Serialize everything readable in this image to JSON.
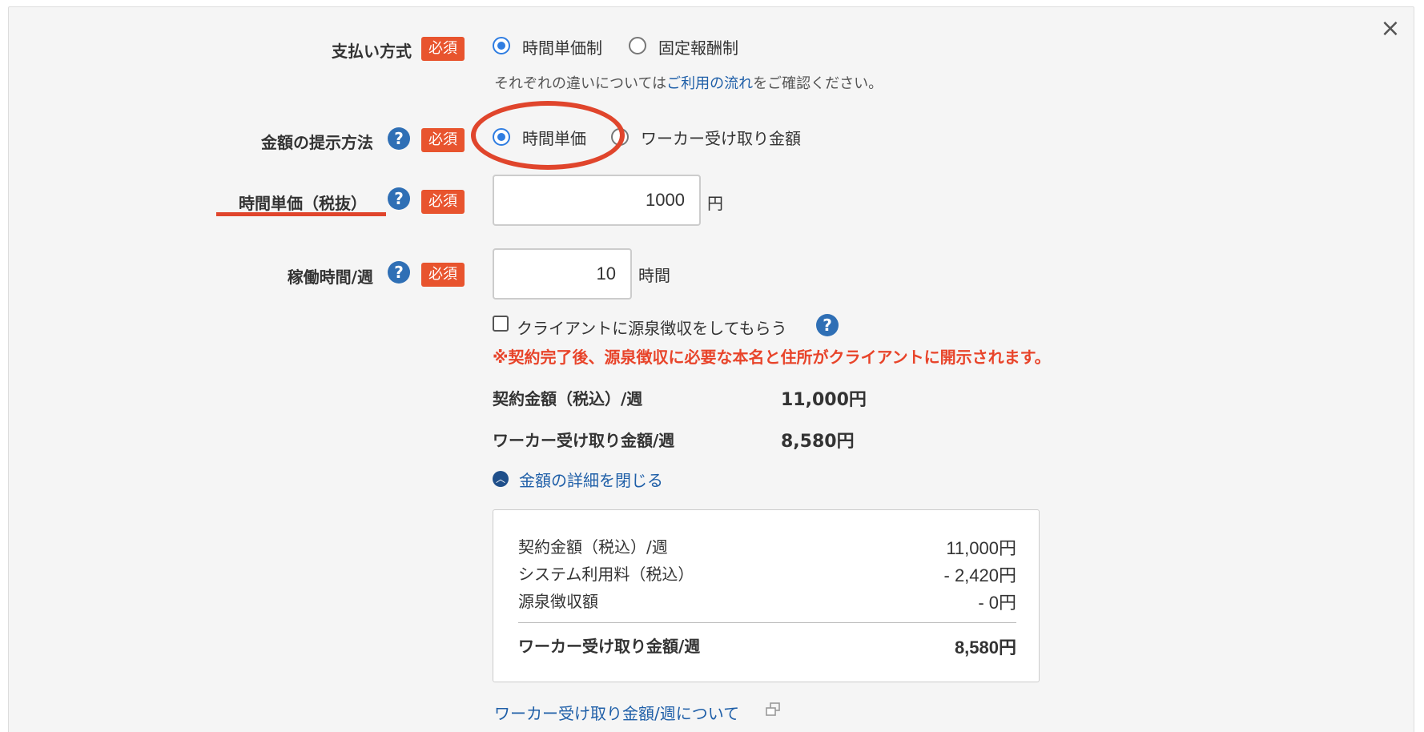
{
  "close_icon": "×",
  "payment_method": {
    "label": "支払い方式",
    "required": "必須",
    "options": [
      "時間単価制",
      "固定報酬制"
    ],
    "selected": "時間単価制",
    "note_prefix": "それぞれの違いについては",
    "note_link": "ご利用の流れ",
    "note_suffix": "をご確認ください。"
  },
  "amount_method": {
    "label": "金額の提示方法",
    "help": "?",
    "required": "必須",
    "options": [
      "時間単価",
      "ワーカー受け取り金額"
    ],
    "selected": "時間単価"
  },
  "hourly_rate": {
    "label": "時間単価（税抜）",
    "help": "?",
    "required": "必須",
    "value": "1000",
    "unit": "円"
  },
  "weekly_hours": {
    "label": "稼働時間/週",
    "help": "?",
    "required": "必須",
    "value": "10",
    "unit": "時間"
  },
  "withholding": {
    "checkbox_label": "クライアントに源泉徴収をしてもらう",
    "checked": false,
    "help": "?",
    "warning": "※契約完了後、源泉徴収に必要な本名と住所がクライアントに開示されます。"
  },
  "summary": {
    "contract_label": "契約金額（税込）/週",
    "contract_value": "11,000円",
    "worker_label": "ワーカー受け取り金額/週",
    "worker_value": "8,580円"
  },
  "details_toggle": {
    "icon": "chevron-up-icon",
    "label": "金額の詳細を閉じる"
  },
  "details": {
    "rows": [
      {
        "label": "契約金額（税込）/週",
        "value": "11,000円"
      },
      {
        "label": "システム利用料（税込）",
        "value": "- 2,420円"
      },
      {
        "label": "源泉徴収額",
        "value": "- 0円"
      }
    ],
    "total_label": "ワーカー受け取り金額/週",
    "total_value": "8,580円"
  },
  "bottom_link": "ワーカー受け取り金額/週について",
  "colors": {
    "accent": "#2f7de1",
    "required_badge": "#e8542e",
    "warning": "#e8442a",
    "link": "#1f5fa8",
    "annotation": "#e0452c"
  }
}
